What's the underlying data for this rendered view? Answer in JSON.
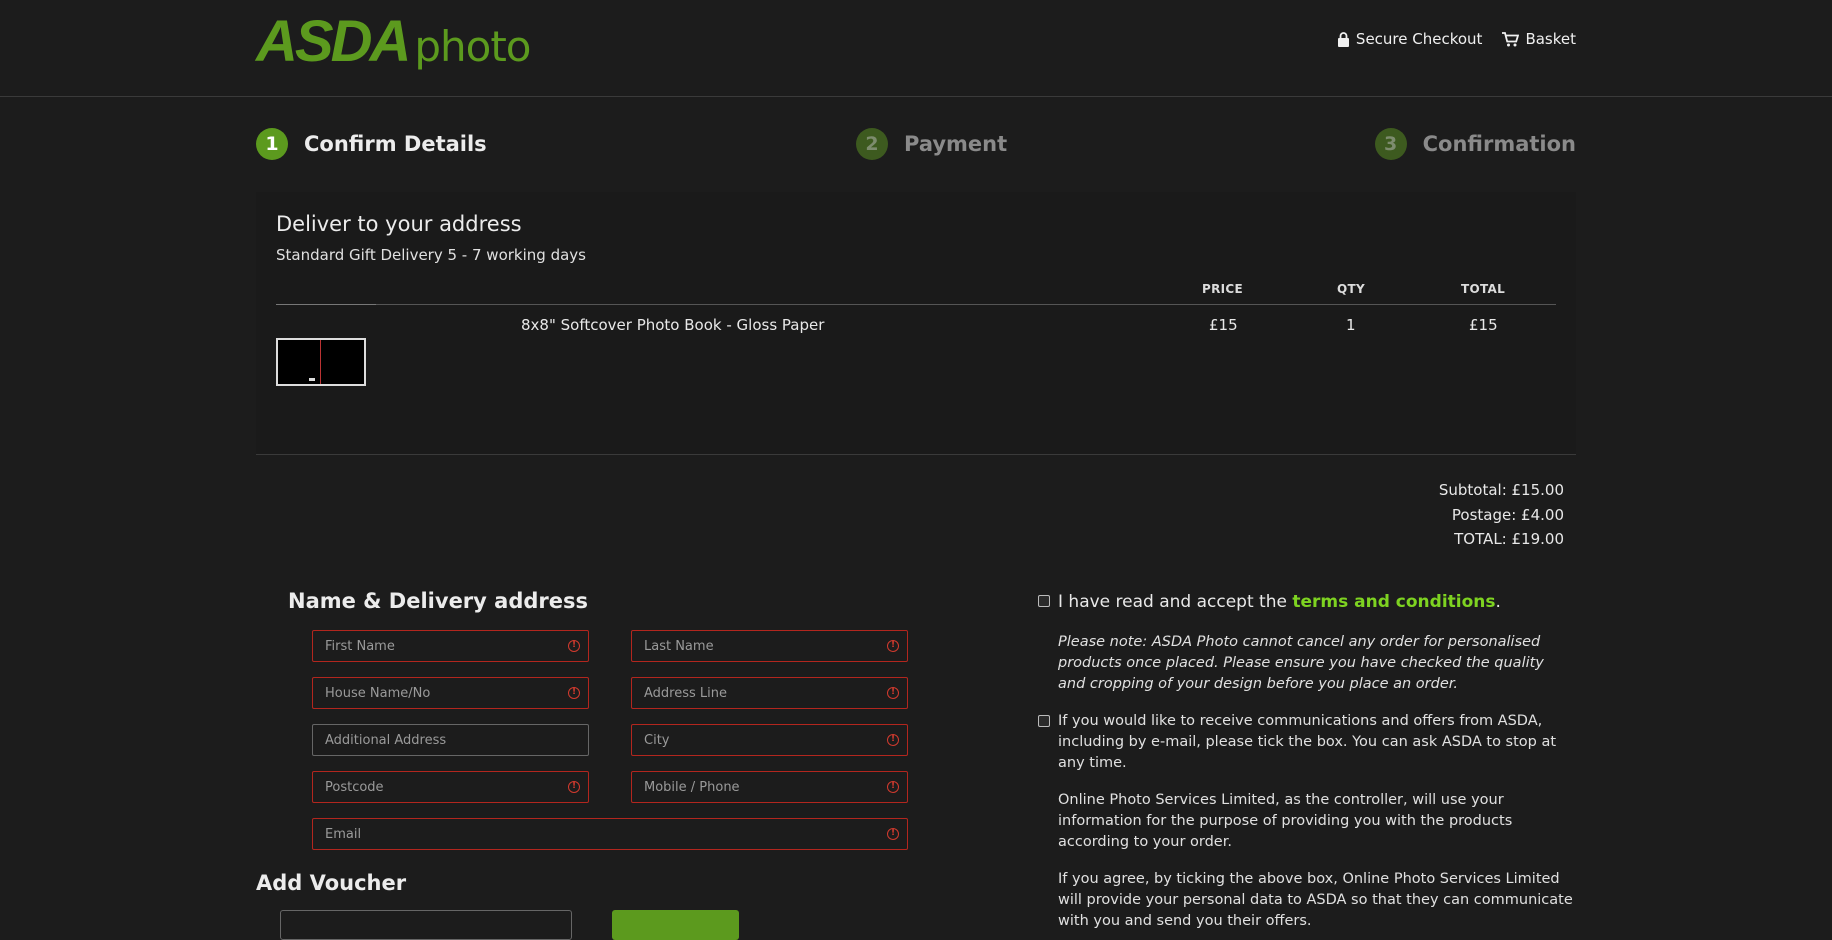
{
  "header": {
    "logo_main": "ASDA",
    "logo_sub": "photo",
    "secure_checkout": "Secure Checkout",
    "basket": "Basket"
  },
  "steps": [
    {
      "num": "1",
      "label": "Confirm Details"
    },
    {
      "num": "2",
      "label": "Payment"
    },
    {
      "num": "3",
      "label": "Confirmation"
    }
  ],
  "delivery": {
    "title": "Deliver to your address",
    "subtitle": "Standard Gift Delivery 5 - 7 working days"
  },
  "table": {
    "headers": {
      "price": "PRICE",
      "qty": "QTY",
      "total": "TOTAL"
    },
    "items": [
      {
        "name": "8x8\" Softcover Photo Book - Gloss Paper",
        "price": "£15",
        "qty": "1",
        "total": "£15"
      }
    ]
  },
  "totals": {
    "subtotal": "Subtotal: £15.00",
    "postage": "Postage: £4.00",
    "total": "TOTAL: £19.00"
  },
  "form": {
    "title": "Name & Delivery address",
    "first_name": "First Name",
    "last_name": "Last Name",
    "house": "House Name/No",
    "address_line": "Address Line",
    "additional_address": "Additional Address",
    "city": "City",
    "postcode": "Postcode",
    "phone": "Mobile / Phone",
    "email": "Email"
  },
  "voucher": {
    "title": "Add Voucher"
  },
  "consent": {
    "terms_prefix": "I have read and accept the ",
    "terms_link": "terms and conditions",
    "terms_suffix": ".",
    "note": "Please note: ASDA Photo cannot cancel any order for personalised products once placed. Please ensure you have checked the quality and cropping of your design before you place an order.",
    "marketing": "If you would like to receive communications and offers from ASDA, including by e-mail, please tick the box. You can ask ASDA to stop at any time.",
    "controller": "Online Photo Services Limited, as the controller, will use your information for the purpose of providing you with the products according to your order.",
    "share": "If you agree, by ticking the above box, Online Photo Services Limited will provide your personal data to ASDA so that they can communicate with you and send you their offers."
  },
  "colors": {
    "brand_green": "#5c9a1e",
    "link_green": "#7ed321",
    "error_red": "#b3261e",
    "background": "#1c1c1c"
  },
  "icons": {
    "secure": "lock-icon",
    "basket": "cart-icon",
    "field_error": "error-icon"
  }
}
